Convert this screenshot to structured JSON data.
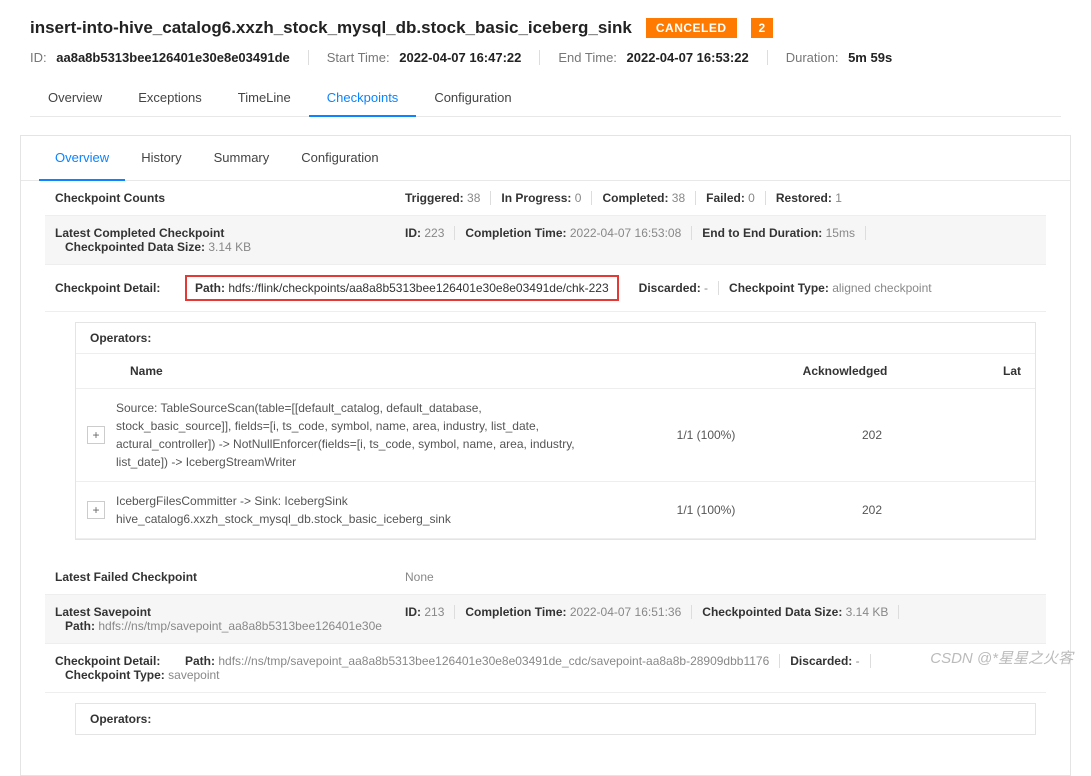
{
  "header": {
    "title": "insert-into-hive_catalog6.xxzh_stock_mysql_db.stock_basic_iceberg_sink",
    "status": "CANCELED",
    "count": "2",
    "id_label": "ID:",
    "id": "aa8a8b5313bee126401e30e8e03491de",
    "start_label": "Start Time:",
    "start": "2022-04-07 16:47:22",
    "end_label": "End Time:",
    "end": "2022-04-07 16:53:22",
    "duration_label": "Duration:",
    "duration": "5m 59s"
  },
  "tabs": [
    "Overview",
    "Exceptions",
    "TimeLine",
    "Checkpoints",
    "Configuration"
  ],
  "active_tab": "Checkpoints",
  "sub_tabs": [
    "Overview",
    "History",
    "Summary",
    "Configuration"
  ],
  "active_sub_tab": "Overview",
  "checkpoint_counts": {
    "label": "Checkpoint Counts",
    "triggered_label": "Triggered:",
    "triggered": "38",
    "in_progress_label": "In Progress:",
    "in_progress": "0",
    "completed_label": "Completed:",
    "completed": "38",
    "failed_label": "Failed:",
    "failed": "0",
    "restored_label": "Restored:",
    "restored": "1"
  },
  "latest_completed": {
    "label": "Latest Completed Checkpoint",
    "id_label": "ID:",
    "id": "223",
    "completion_label": "Completion Time:",
    "completion": "2022-04-07 16:53:08",
    "e2e_label": "End to End Duration:",
    "e2e": "15ms",
    "size_label": "Checkpointed Data Size:",
    "size": "3.14 KB"
  },
  "checkpoint_detail": {
    "label": "Checkpoint Detail:",
    "path_label": "Path:",
    "path": "hdfs:/flink/checkpoints/aa8a8b5313bee126401e30e8e03491de/chk-223",
    "discarded_label": "Discarded:",
    "discarded": "-",
    "type_label": "Checkpoint Type:",
    "type": "aligned checkpoint"
  },
  "operators": {
    "label": "Operators:",
    "columns": {
      "name": "Name",
      "ack": "Acknowledged",
      "lat": "Lat"
    },
    "rows": [
      {
        "name": "Source: TableSourceScan(table=[[default_catalog, default_database, stock_basic_source]], fields=[i, ts_code, symbol, name, area, industry, list_date, actural_controller]) -> NotNullEnforcer(fields=[i, ts_code, symbol, name, area, industry, list_date]) -> IcebergStreamWriter",
        "ack": "1/1 (100%)",
        "lat": "202"
      },
      {
        "name": "IcebergFilesCommitter -> Sink: IcebergSink hive_catalog6.xxzh_stock_mysql_db.stock_basic_iceberg_sink",
        "ack": "1/1 (100%)",
        "lat": "202"
      }
    ]
  },
  "latest_failed": {
    "label": "Latest Failed Checkpoint",
    "value": "None"
  },
  "latest_savepoint": {
    "label": "Latest Savepoint",
    "id_label": "ID:",
    "id": "213",
    "completion_label": "Completion Time:",
    "completion": "2022-04-07 16:51:36",
    "size_label": "Checkpointed Data Size:",
    "size": "3.14 KB",
    "path_label": "Path:",
    "path": "hdfs://ns/tmp/savepoint_aa8a8b5313bee126401e30e"
  },
  "savepoint_detail": {
    "label": "Checkpoint Detail:",
    "path_label": "Path:",
    "path": "hdfs://ns/tmp/savepoint_aa8a8b5313bee126401e30e8e03491de_cdc/savepoint-aa8a8b-28909dbb1176",
    "discarded_label": "Discarded:",
    "discarded": "-",
    "type_label": "Checkpoint Type:",
    "type": "savepoint"
  },
  "operators2": {
    "label": "Operators:"
  },
  "watermark": "CSDN @*星星之火客"
}
